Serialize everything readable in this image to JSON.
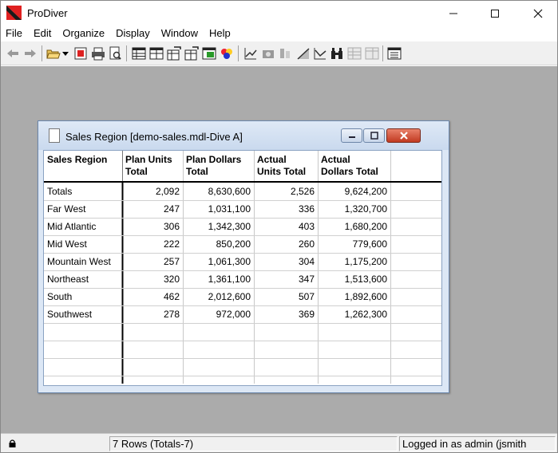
{
  "app": {
    "title": "ProDiver",
    "logo_colors": {
      "dark": "#1a1a1a",
      "accent": "#e02020"
    }
  },
  "window_controls": {
    "minimize": "—",
    "maximize": "☐",
    "close": "✕"
  },
  "menu": [
    "File",
    "Edit",
    "Organize",
    "Display",
    "Window",
    "Help"
  ],
  "toolbar": {
    "icons": [
      "back-arrow-icon",
      "forward-arrow-icon",
      "open-folder-icon",
      "dropdown-arrow-icon",
      "stop-icon",
      "print-icon",
      "print-preview-icon",
      "table-icon",
      "multi-table-icon",
      "pivot-table-icon",
      "pivot-table-2-icon",
      "color-table-icon",
      "chart-colors-icon",
      "line-chart-icon",
      "camera-icon",
      "columns-icon",
      "area-chart-icon",
      "trend-chart-icon",
      "binoculars-icon",
      "grid-icon",
      "grid-2-icon",
      "details-icon"
    ]
  },
  "child_window": {
    "title": "Sales Region [demo-sales.mdl-Dive A]",
    "controls": {
      "minimize": "▁",
      "restore": "▣",
      "close": "✕"
    }
  },
  "table": {
    "columns": [
      {
        "line1": "Sales Region",
        "line2": ""
      },
      {
        "line1": "Plan Units",
        "line2": "Total"
      },
      {
        "line1": "Plan Dollars",
        "line2": "Total"
      },
      {
        "line1": "Actual",
        "line2": "Units Total"
      },
      {
        "line1": "Actual",
        "line2": "Dollars Total"
      }
    ],
    "rows": [
      [
        "Totals",
        "2,092",
        "8,630,600",
        "2,526",
        "9,624,200"
      ],
      [
        "Far West",
        "247",
        "1,031,100",
        "336",
        "1,320,700"
      ],
      [
        "Mid Atlantic",
        "306",
        "1,342,300",
        "403",
        "1,680,200"
      ],
      [
        "Mid West",
        "222",
        "850,200",
        "260",
        "779,600"
      ],
      [
        "Mountain West",
        "257",
        "1,061,300",
        "304",
        "1,175,200"
      ],
      [
        "Northeast",
        "320",
        "1,361,100",
        "347",
        "1,513,600"
      ],
      [
        "South",
        "462",
        "2,012,600",
        "507",
        "1,892,600"
      ],
      [
        "Southwest",
        "278",
        "972,000",
        "369",
        "1,262,300"
      ]
    ]
  },
  "status": {
    "lock_icon": "lock-icon",
    "rows": "7 Rows (Totals-7)",
    "user": "Logged in as admin (jsmith"
  },
  "colors": {
    "workspace": "#ababab",
    "child_border": "#6b87ad",
    "close_red": "#c13a21"
  }
}
